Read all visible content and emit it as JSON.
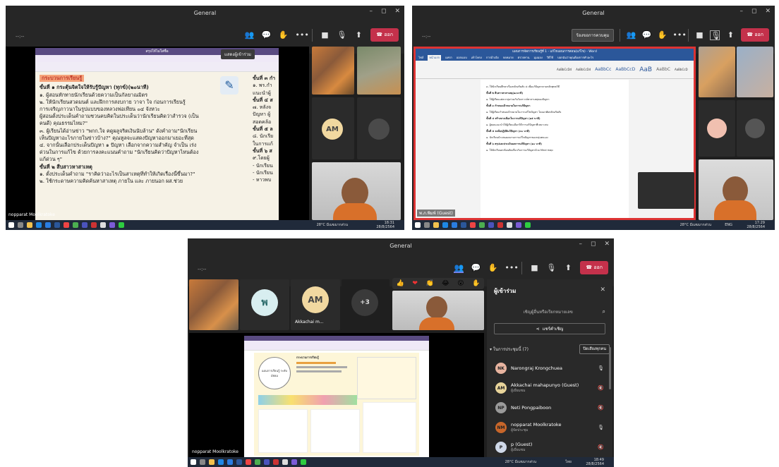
{
  "window_title": "General",
  "meeting_time": "--:--",
  "leave_label": "ออก",
  "request_control_label": "ร้องขอการควบคุม",
  "participants_tooltip": "แสดงผู้เข้าร่วม",
  "taskbar": {
    "weather": "28°C มีเมฆมากส่วน",
    "lang": "ไทย",
    "lang2": "ENG",
    "time1": "18:31",
    "date1": "28/8/2564",
    "time2": "17:29",
    "date2": "28/8/2564",
    "time3": "18:49",
    "date3": "28/8/2564"
  },
  "panel1": {
    "onenote_title": "สรุปให้ไม่ใส่ชื่อ",
    "presenter_name": "nopparat Moolkratoke",
    "doc_lines": [
      "กระบวนการเรียนรู้",
      "ขั้นที่ ๑  กระตุ้นจิตใจให้รับรู้ปัญหา (ทุกข์)(๒๐นาที)",
      "๑. ผู้สอนทักทายนักเรียนด้วยความเป็นกัลยาณมิตร",
      "๒. ให้นักเรียนสวดมนต์ และฝึกการสงบกาย วาจา ใจ ก่อนการเรียนรู้",
      "การเจริญภาวนาในรูปแบบของหลวงพ่อเทียน ๐๔ จังหวะ",
      "ผู้สอนตั้งประเด็นคำถามชวนคบคิดในประเด็นว่านักเรียนคิดว่าสำรวจ (เป็น",
      "คนดี) คุณธรรมไหม?\"",
      "๓. ผู้เรียนได้อ่านข่าว \"พกก.ใจ คดูผลูจริตเงินนับล้าน\" ดังคำถาม\"นักเรียน",
      "เห็นปัญหาอะไรภายในข่าวบ้าง?\" คุณหูลจะแสดงปัญหาออกมาเยอะที่สุด",
      "๔. จากนั้นเลือกประเด็นปัญหา ๑ ปัญหา เลือกจากความสำคัญ จำเป็น เร่ง",
      "ด่วนในการแก้ไข ด้วยการลงคะแนนคำถาม \"นักเรียนคิดว่าปัญหาไหนต้อง",
      "แก้ด่วน ๆ\"",
      "ขั้นที่ ๒  สืบสาวหาสาเหตุ",
      "๑. ตั้งประเด็นคำถาม \"ราคิดว่าอะไรเป็นสาเหตุที่ทำให้เกิดเรื่องนี้ขึ้นมา?\"",
      "๒. ใช้กระดาษความคิดค้นหาสาเหตุ ภายใน และ ภายนอก ผส.ช่วย"
    ],
    "right_lines": [
      "ขั้นที่ ๓ กำ",
      "๑. พร.กำ",
      "แนะนำผู้",
      "ขั้นที่ ๔ ส",
      "๗. หลังจ",
      "ปัญหา ผู้",
      "สอดคล้อ",
      "ขั้นที่ ๕ ล",
      "๘. นักเรีย",
      "ในการแก้",
      "ขั้นที่ ๖ ส",
      "๙.โดยผู้",
      "- นักเรียน",
      "- นักเรียน",
      "- หาวพบ"
    ],
    "tile_am": "AM"
  },
  "panel2": {
    "word_title": "แผนการจัดการเรียนรู้ที่ 1 - แก้ไขแผนการสอน(แก้ไข) - Word",
    "ribbon_tabs": [
      "ไฟล์",
      "หน้าแรก",
      "แทรก",
      "ออกแบบ",
      "เค้าโครง",
      "การอ้างอิง",
      "จดหมาย",
      "ตรวจทาน",
      "มุมมอง",
      "วิธีใช้",
      "บอกฉันว่าคุณต้องการทำอะไร"
    ],
    "styles": [
      "AaBbCcDd",
      "AaBbCcDd",
      "AaBbCc",
      "AaBbCcD",
      "AaB",
      "AaBbC",
      "AaBbCcD"
    ],
    "presenter_name": "พ.ภ.พิมพ์ (Guest)",
    "doc_lines": [
      "๓. ให้นักเรียนศึกษาเรื่องหลักอริยสัจ ๔ เพื่อแก้ปัญหาตามหลักพุทธวิธี",
      "ขั้นที่ ๒  สืบสาวหาสาเหตุ(๑๐นาที)",
      "๑. ให้ผู้เรียนแต่ละกลุ่มร่วมกันวิเคราะห์หาสาเหตุของปัญหา",
      "ขั้นที่ ๓  กำหนดเป้าหมายในการแก้ปัญหา",
      "๑. ให้ผู้เรียนกำหนดเป้าหมายในการแก้ไขปัญหา โดยอาศัยหลักอริยสัจ",
      "ขั้นที่ ๔  สร้างทางเลือกในการแก้ปัญหา (๑๕ นาที)",
      "๑. ผู้สอนแนะนำให้ผู้เรียนเลือกวิธีการแก้ปัญหาที่เหมาะสม",
      "ขั้นที่ ๕  ลงมือปฏิบัติแก้ปัญหา (๓๐ นาที)",
      "๑. นักเรียนนำเสนอผลงานการแก้ไขปัญหาของกลุ่มตนเอง",
      "ขั้นที่ ๖  สรุปและประเมินผลการแก้ปัญหา (๑๐ นาที)",
      "๑. ให้นักเรียนสะท้อนคิดเกี่ยวกับการแก้ปัญหาด้วย Mind map"
    ]
  },
  "panel3": {
    "tiles": [
      {
        "initial": "พ",
        "name": ""
      },
      {
        "initial": "AM",
        "name": "Akkachai m..."
      },
      {
        "initial": "+3",
        "name": ""
      }
    ],
    "presenter_name": "nopparat Moolkratoke",
    "reactions": [
      "👍",
      "❤",
      "👏",
      "😂",
      "😮",
      "✋"
    ],
    "panel_title": "ผู้เข้าร่วม",
    "search_placeholder": "เชิญผู้อื่นหรือเรียกหมายเลข",
    "share_invite": "แชร์คำเชิญ",
    "section_label": "ในการประชุมนี้ (7)",
    "mute_all": "ปิดเสียงทุกคน",
    "participants": [
      {
        "initials": "NK",
        "name": "Narongraj Krongchuea",
        "role": "",
        "color": "#e8b4a0"
      },
      {
        "initials": "AM",
        "name": "Akkachai mahapunyo (Guest)",
        "role": "ผู้เยี่ยมชม",
        "color": "#e8d49a"
      },
      {
        "initials": "NP",
        "name": "Neti Pongpaiboon",
        "role": "",
        "color": "#9a9a9a"
      },
      {
        "initials": "NM",
        "name": "nopparat Moolkratoke",
        "role": "ผู้จัดประชุม",
        "color": "#c8662a"
      },
      {
        "initials": "P",
        "name": "p (Guest)",
        "role": "ผู้เยี่ยมชม",
        "color": "#cfd8e8"
      }
    ],
    "slide_title": "กระบวนการเรียนรู้",
    "slide_center": "แผนการเรียนรู้ ระดับมัธยม"
  }
}
